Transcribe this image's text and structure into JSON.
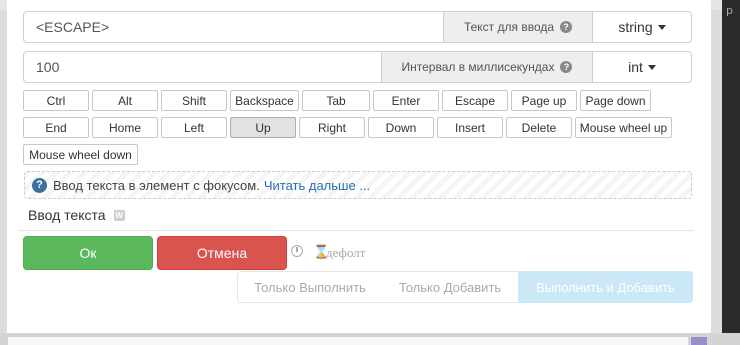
{
  "input_text": {
    "value": "<ESCAPE>",
    "label": "Текст для ввода",
    "type": "string"
  },
  "input_interval": {
    "value": "100",
    "label": "Интервал в миллисекундах",
    "type": "int"
  },
  "keys": {
    "ctrl": "Ctrl",
    "alt": "Alt",
    "shift": "Shift",
    "backspace": "Backspace",
    "tab": "Tab",
    "enter": "Enter",
    "escape": "Escape",
    "pageup": "Page up",
    "pagedown": "Page down",
    "end": "End",
    "home": "Home",
    "left": "Left",
    "up": "Up",
    "right": "Right",
    "down": "Down",
    "insert": "Insert",
    "delete": "Delete",
    "wheelup": "Mouse wheel up",
    "wheeldown": "Mouse wheel down"
  },
  "info": {
    "text": "Ввод текста в элемент с фокусом.",
    "link": "Читать дальше ..."
  },
  "title": "Ввод текста",
  "buttons": {
    "ok": "Ок",
    "cancel": "Отмена",
    "default": "дефолт",
    "run_only": "Только Выполнить",
    "add_only": "Только Добавить",
    "run_add": "Выполнить и Добавить"
  }
}
